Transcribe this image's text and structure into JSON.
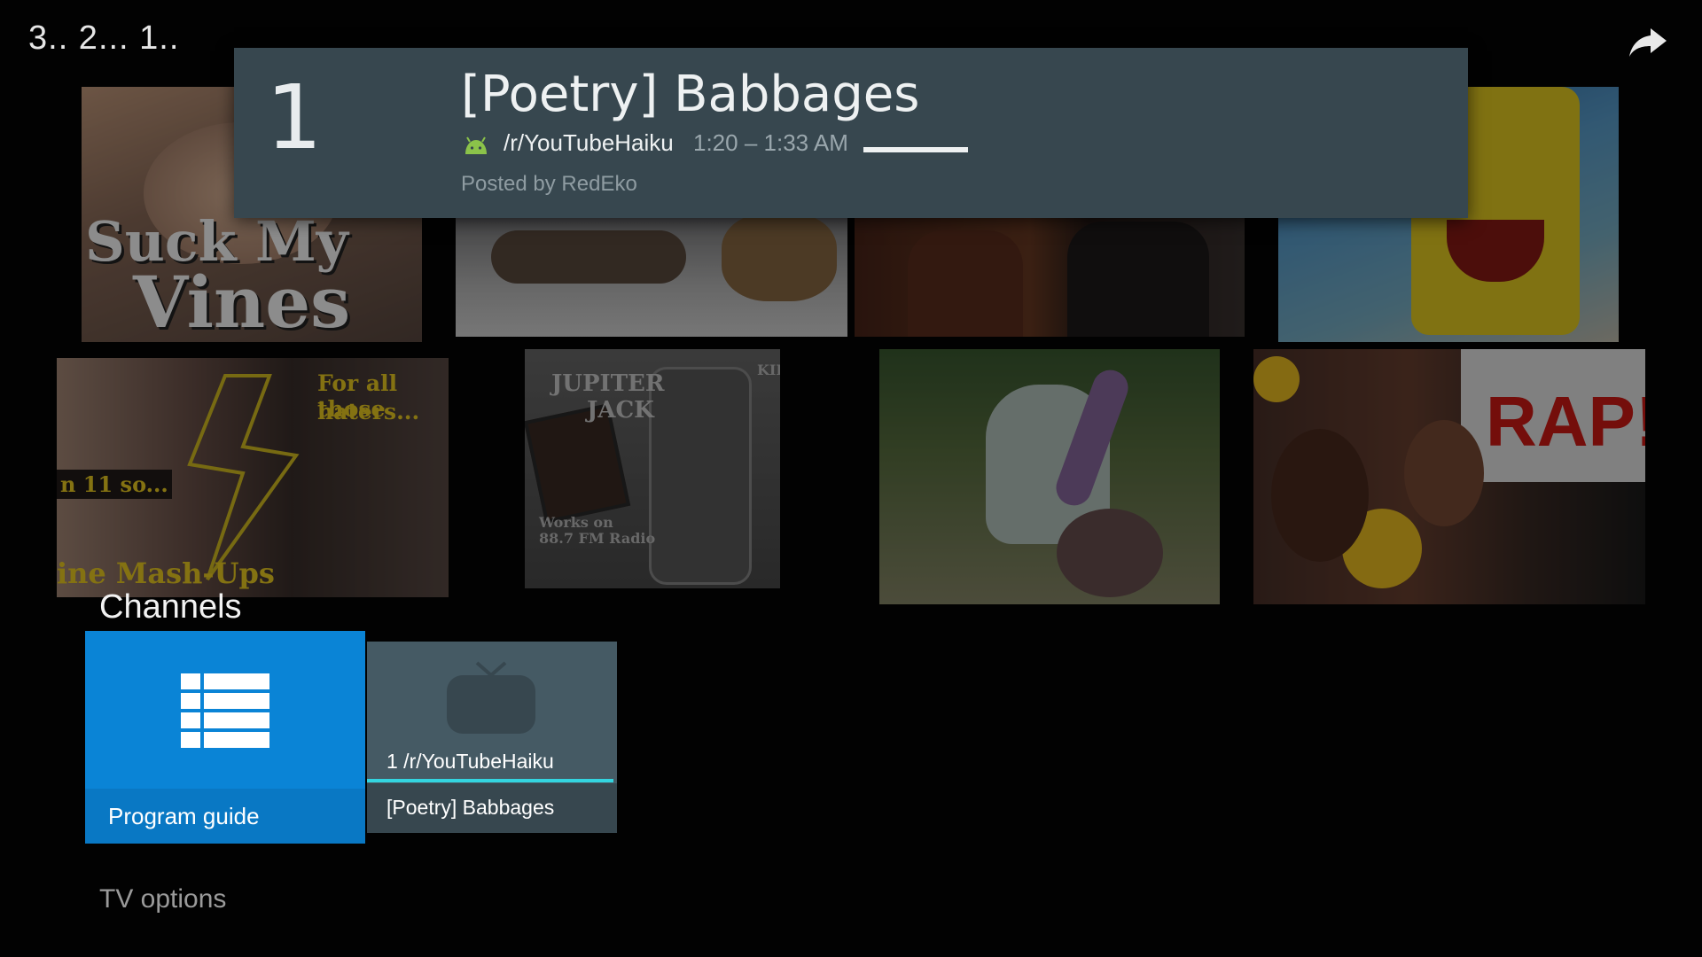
{
  "header": {
    "title": "3.. 2... 1..",
    "share_icon": "share-arrow-icon"
  },
  "background_thumbnails": [
    {
      "name": "thumb-suck-my-vines",
      "text_1": "Suck My",
      "text_2": "Vines"
    },
    {
      "name": "thumb-bed-teddy",
      "text_1": ""
    },
    {
      "name": "thumb-two-people",
      "text_1": ""
    },
    {
      "name": "thumb-spongebob",
      "text_1": ""
    },
    {
      "name": "thumb-mash-ups",
      "text_1": "For all those",
      "text_2": "haters...",
      "text_3": "n 11 so...",
      "text_4": "ine Mash-Ups"
    },
    {
      "name": "thumb-jupiter-jack",
      "text_1": "JUPITER",
      "text_2": "JACK",
      "text_3": "Works on",
      "text_4": "88.7 FM Radio",
      "text_5": "KII"
    },
    {
      "name": "thumb-squidward",
      "text_1": ""
    },
    {
      "name": "thumb-rap-reaction",
      "text_1": "RAP!"
    }
  ],
  "info_panel": {
    "channel_number": "1",
    "program_title": "[Poetry] Babbages",
    "channel_name": "/r/YouTubeHaiku",
    "time_range": "1:20 – 1:33 AM",
    "posted_by": "Posted by RedEko",
    "progress_fraction": 1.0,
    "icon": "android-icon"
  },
  "channels": {
    "heading": "Channels",
    "program_guide_label": "Program guide",
    "program_guide_icon": "list-grid-icon",
    "channel_card": {
      "label": "1 /r/YouTubeHaiku",
      "program": "[Poetry] Babbages",
      "icon": "tv-icon",
      "progress_fraction": 1.0
    }
  },
  "tv_options_label": "TV options",
  "colors": {
    "panel": "#37474f",
    "accent_blue": "#0a84d6",
    "progress_cyan": "#33d5e0",
    "android_green": "#8bc34a"
  }
}
